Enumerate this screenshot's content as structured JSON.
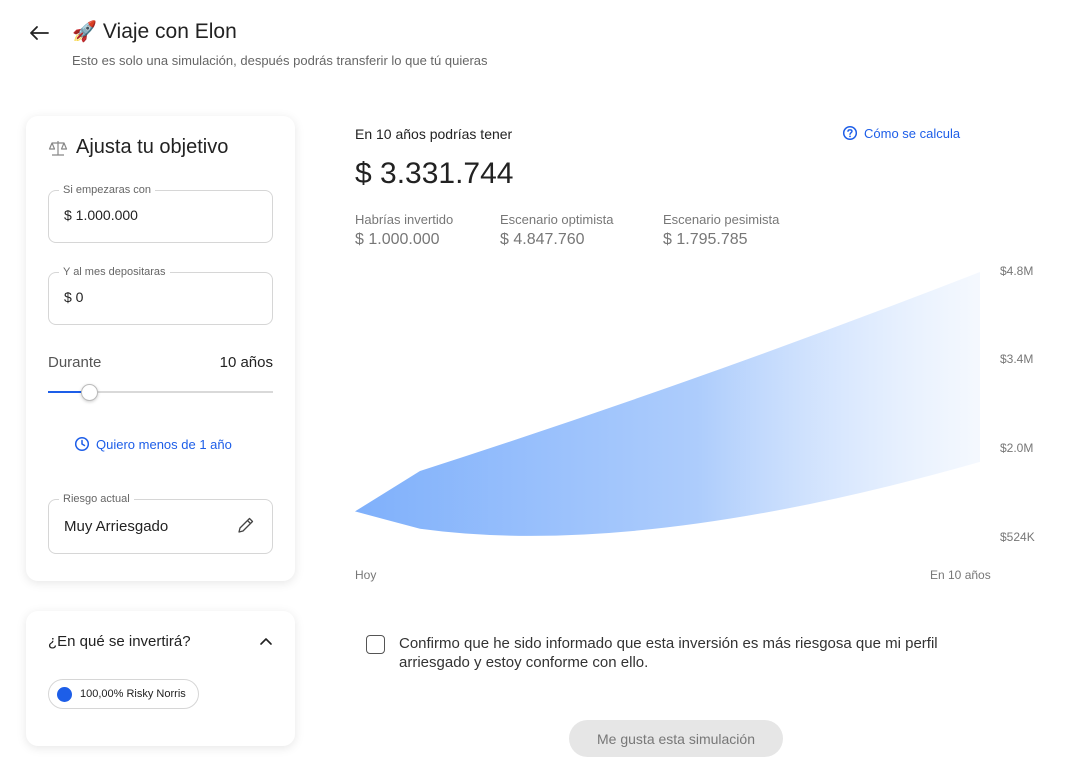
{
  "header": {
    "rocket_glyph": "🚀",
    "title": "Viaje con Elon",
    "subtitle": "Esto es solo una simulación, después podrás transferir lo que tú quieras"
  },
  "objective": {
    "title": "Ajusta tu objetivo",
    "initial": {
      "label": "Si empezaras con",
      "value": "$ 1.000.000"
    },
    "monthly": {
      "label": "Y al mes depositaras",
      "value": "$ 0"
    },
    "duration": {
      "label": "Durante",
      "value": "10 años",
      "slider_fraction": 0.18
    },
    "less_than_year_link": "Quiero menos de 1 año",
    "risk": {
      "label": "Riesgo actual",
      "value": "Muy Arriesgado"
    }
  },
  "investment": {
    "title": "¿En qué se invertirá?",
    "chip": "100,00% Risky Norris",
    "chip_color": "#1d5ee8"
  },
  "result": {
    "heading": "En 10 años podrías tener",
    "how_link": "Cómo se calcula",
    "amount": "$ 3.331.744",
    "stats": [
      {
        "label": "Habrías invertido",
        "value": "$ 1.000.000"
      },
      {
        "label": "Escenario optimista",
        "value": "$ 4.847.760"
      },
      {
        "label": "Escenario pesimista",
        "value": "$ 1.795.785"
      }
    ]
  },
  "chart_data": {
    "type": "area",
    "x_labels": [
      "Hoy",
      "En 10 años"
    ],
    "y_ticks": [
      {
        "value": 4800000,
        "label": "$4.8M"
      },
      {
        "value": 3400000,
        "label": "$3.4M"
      },
      {
        "value": 2000000,
        "label": "$2.0M"
      },
      {
        "value": 524000,
        "label": "$524K"
      }
    ],
    "ylim": [
      524000,
      4800000
    ],
    "start_value": 1000000,
    "upper": [
      1000000,
      1650000,
      4847760
    ],
    "lower": [
      1000000,
      720000,
      1795785
    ],
    "color": "#7fb0fb"
  },
  "confirm_text": "Confirmo que he sido informado que esta inversión es más riesgosa que mi perfil arriesgado y estoy conforme con ello.",
  "submit_label": "Me gusta esta simulación"
}
